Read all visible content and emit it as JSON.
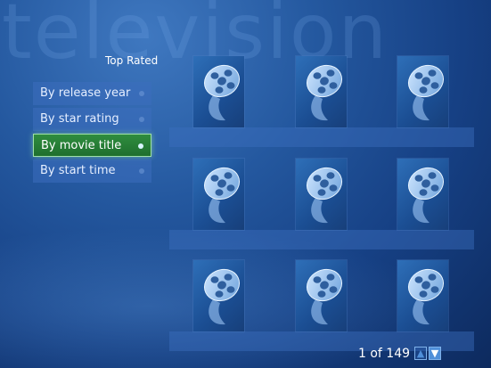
{
  "watermark": "television",
  "section_title": "Top Rated",
  "menu": {
    "items": [
      {
        "label": "By release year",
        "selected": false
      },
      {
        "label": "By star rating",
        "selected": false
      },
      {
        "label": "By movie title",
        "selected": true
      },
      {
        "label": "By start time",
        "selected": false
      }
    ]
  },
  "grid": {
    "rows": 3,
    "cols": 3,
    "tile_icon": "film-reel-icon"
  },
  "pager": {
    "text": "1 of 149",
    "up_icon": "chevron-up-icon",
    "down_icon": "chevron-down-icon"
  },
  "colors": {
    "selected_accent": "#2f8d3e",
    "background": "#1b4e93"
  }
}
